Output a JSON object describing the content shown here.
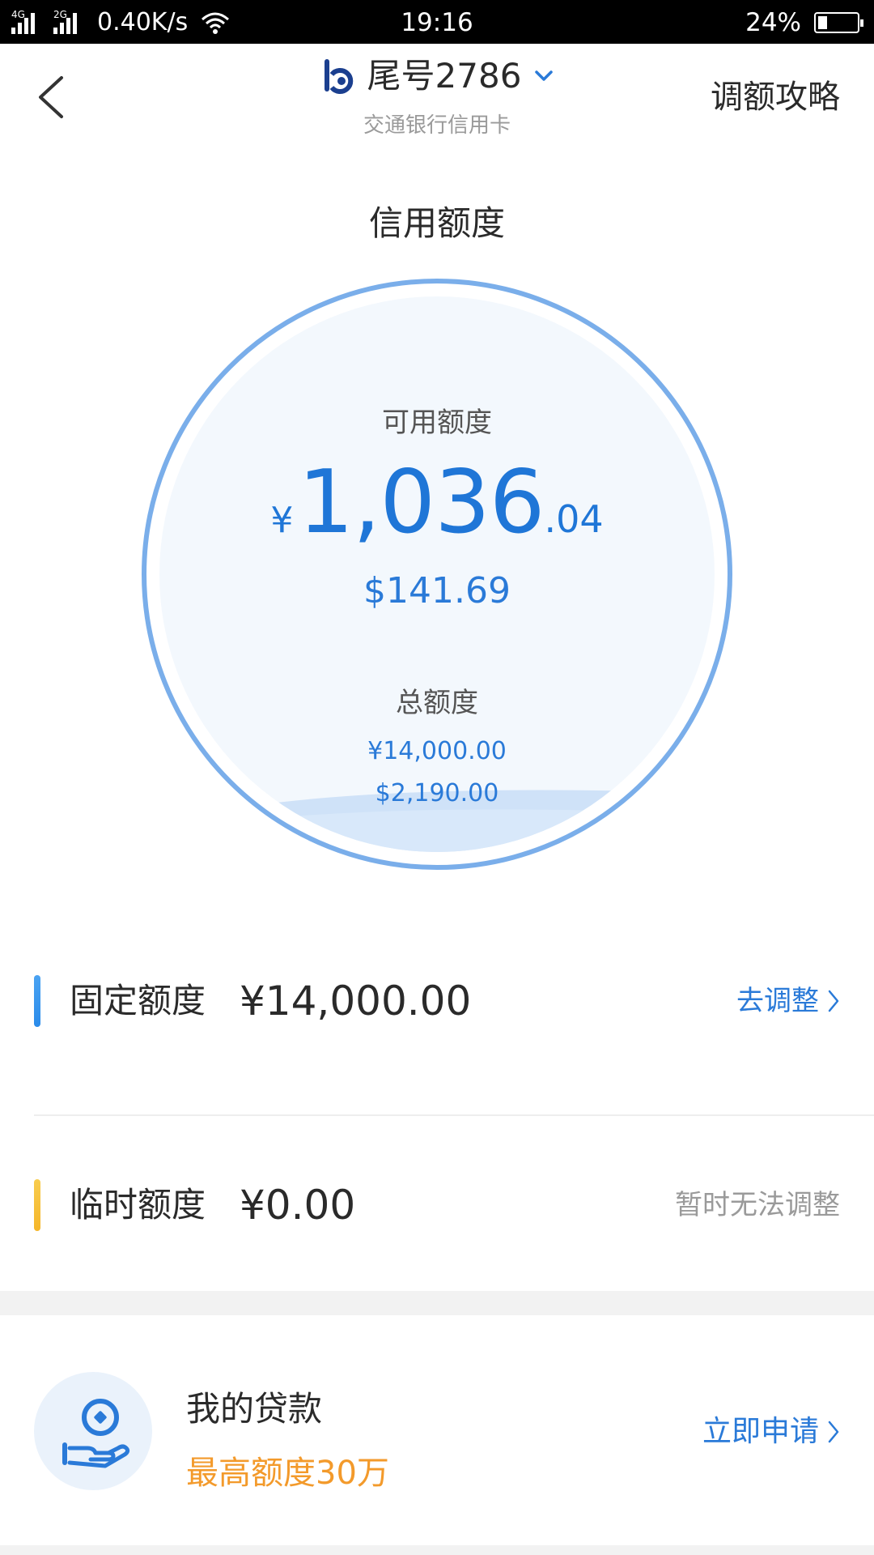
{
  "status_bar": {
    "net_tag_1": "4G",
    "net_tag_2": "2G",
    "speed": "0.40K/s",
    "time": "19:16",
    "battery": "24%",
    "battery_level": 0.24
  },
  "header": {
    "back_icon": "chevron-left-icon",
    "card_title": "尾号2786",
    "card_subtitle": "交通银行信用卡",
    "guide_label": "调额攻略"
  },
  "limit": {
    "section_title": "信用额度",
    "available_label": "可用额度",
    "available_currency": "¥",
    "available_integer": "1,036",
    "available_decimal": ".04",
    "available_usd": "$141.69",
    "total_label": "总额度",
    "total_cny": "¥14,000.00",
    "total_usd": "$2,190.00"
  },
  "rows": {
    "fixed": {
      "label": "固定额度",
      "value": "¥14,000.00",
      "action": "去调整",
      "accent": "#2a8bea"
    },
    "temporary": {
      "label": "临时额度",
      "value": "¥0.00",
      "action": "暂时无法调整",
      "accent": "#f5b62a"
    }
  },
  "loan": {
    "icon": "loan-hand-coin-icon",
    "title": "我的贷款",
    "subtitle": "最高额度30万",
    "action": "立即申请"
  },
  "colors": {
    "primary_blue": "#1f76d7",
    "orange": "#f39a2b",
    "ring_blue": "#7aaeea"
  }
}
